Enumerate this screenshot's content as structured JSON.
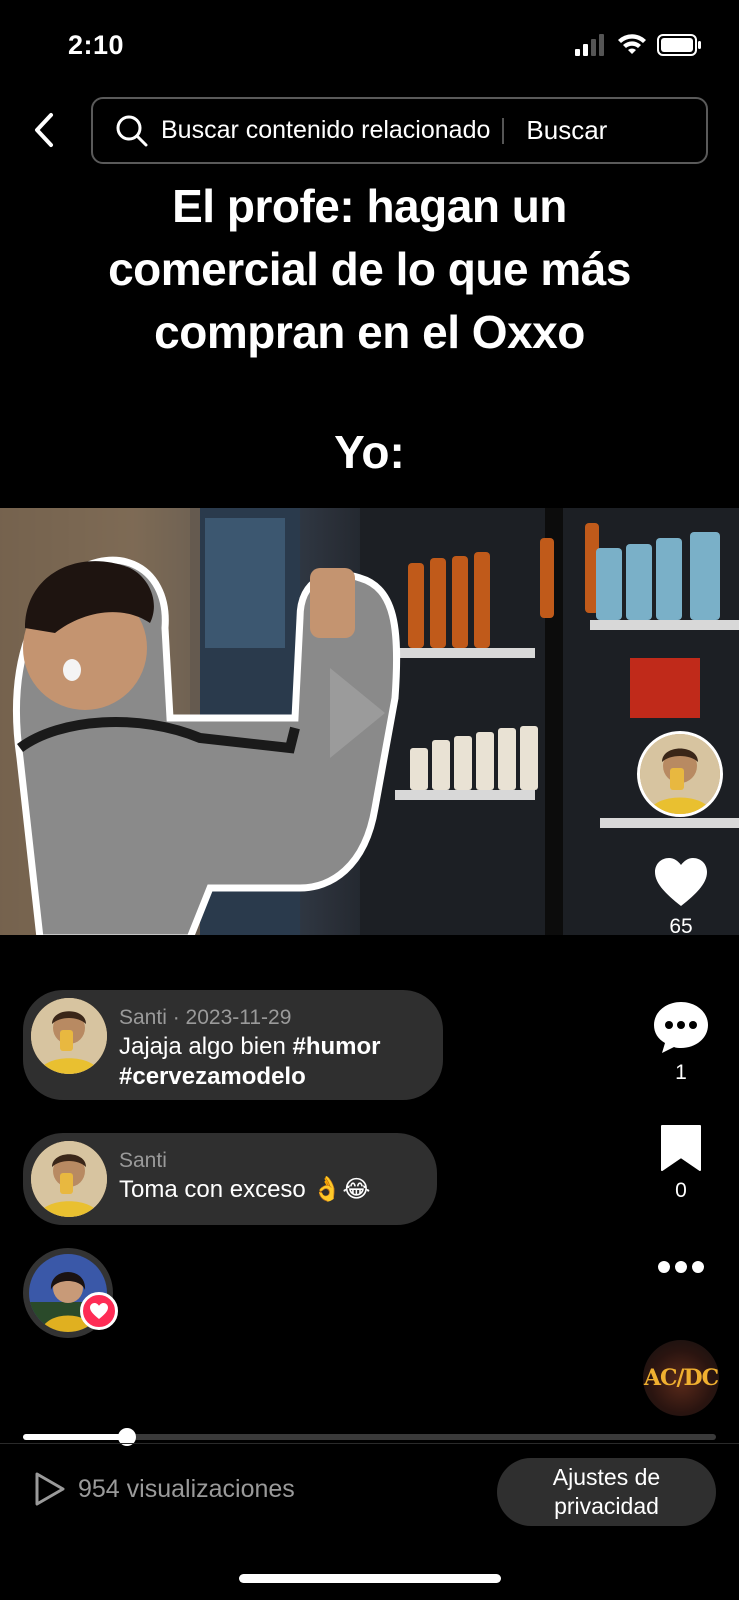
{
  "status_bar": {
    "time": "2:10",
    "icons": [
      "cellular-signal-icon",
      "wifi-icon",
      "battery-icon"
    ]
  },
  "search": {
    "placeholder": "Buscar contenido relacionado",
    "submit_label": "Buscar"
  },
  "video": {
    "caption_lines": [
      "El profe: hagan un",
      "comercial de lo que más",
      "compran en el Oxxo"
    ],
    "caption_punch": "Yo:"
  },
  "actions": {
    "likes": "65",
    "comments": "1",
    "saves": "0"
  },
  "comments": [
    {
      "author": "Santi",
      "meta": "Santi · 2023-11-29",
      "text_plain": "Jajaja algo bien ",
      "hashtags": [
        "#humor",
        "#cervezamodelo"
      ]
    },
    {
      "author": "Santi",
      "meta": "Santi",
      "text": "Toma con exceso 👌😂"
    }
  ],
  "music": {
    "disc_label": "AC/DC"
  },
  "playback": {
    "progress": 0.15
  },
  "footer": {
    "views": "954 visualizaciones",
    "privacy_line1": "Ajustes de",
    "privacy_line2": "privacidad"
  },
  "colors": {
    "background": "#000000",
    "accent_like": "#fe2c55",
    "pill_background": "#2f2f2f",
    "muted_text": "#9a9a9a"
  }
}
